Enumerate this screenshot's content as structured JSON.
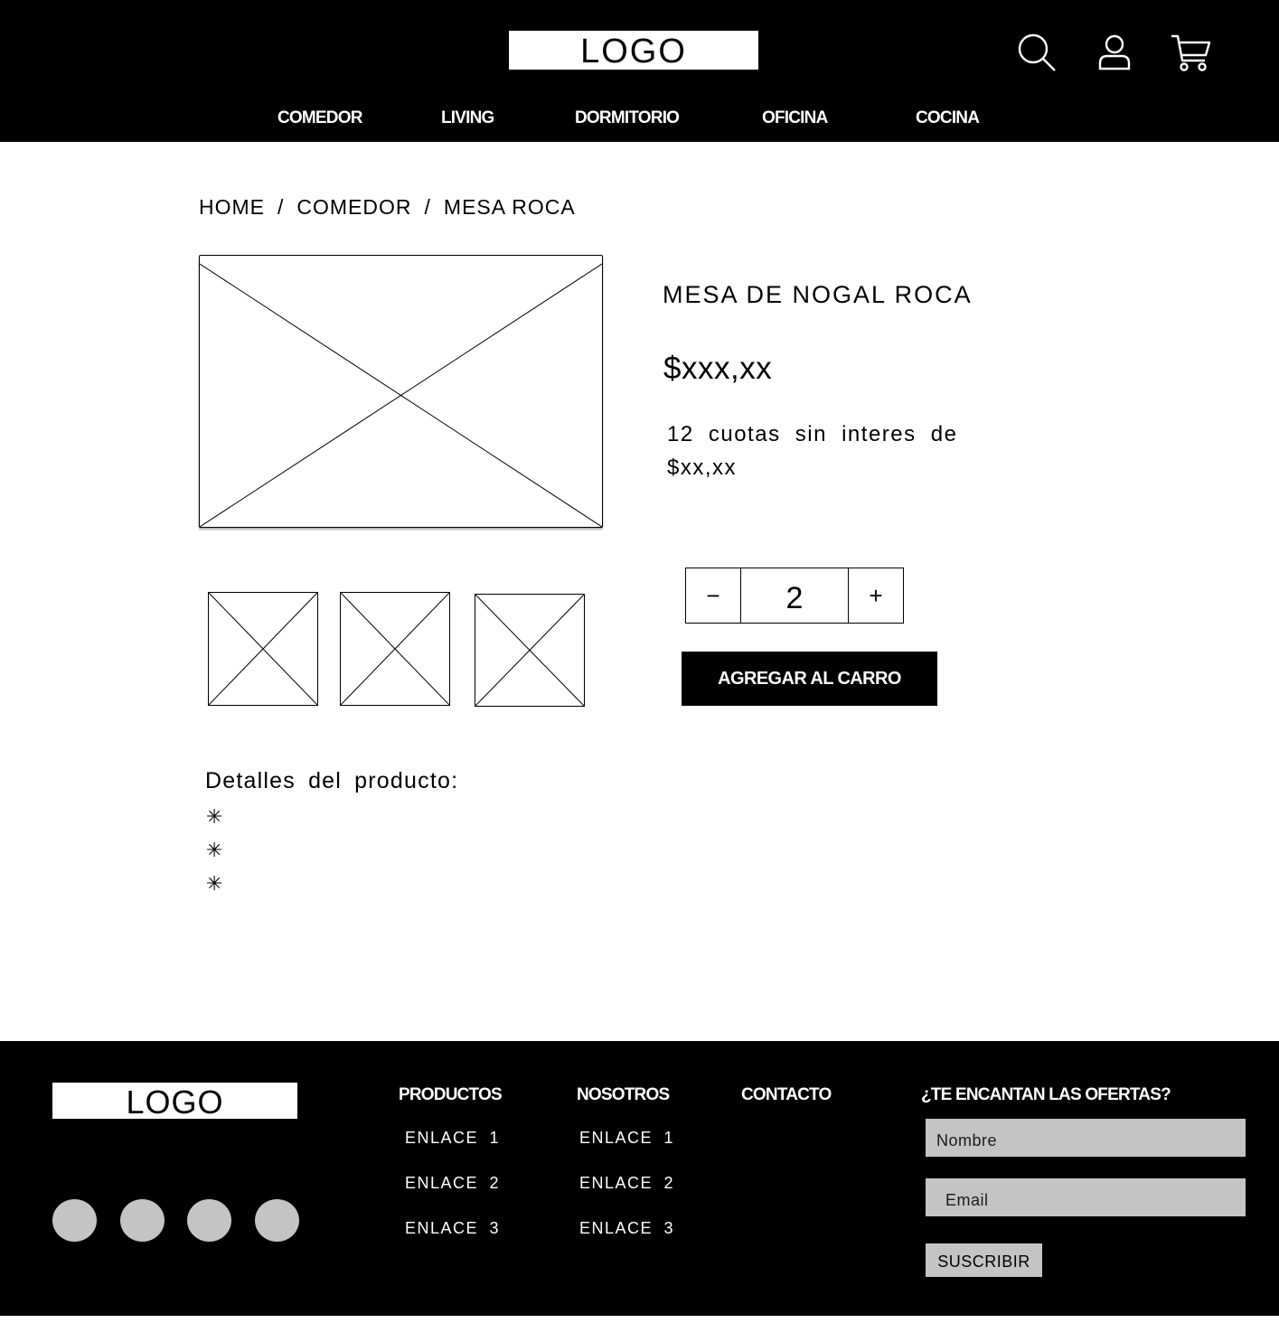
{
  "header": {
    "logo": "LOGO",
    "icons": [
      "search-icon",
      "user-icon",
      "cart-icon"
    ],
    "nav": [
      {
        "label": "COMEDOR"
      },
      {
        "label": "LIVING"
      },
      {
        "label": "DORMITORIO"
      },
      {
        "label": "OFICINA"
      },
      {
        "label": "COCINA"
      }
    ]
  },
  "breadcrumb": {
    "items": [
      "HOME",
      "COMEDOR",
      "MESA ROCA"
    ],
    "separator": "/"
  },
  "product": {
    "title": "MESA DE NOGAL ROCA",
    "price": "$xxx,xx",
    "installments": "12 cuotas sin interes de $xx,xx",
    "quantity": {
      "minus": "−",
      "value": "2",
      "plus": "+"
    },
    "add_to_cart": "AGREGAR AL CARRO",
    "details_title": "Detalles del producto:",
    "detail_bullets": [
      "✳",
      "✳",
      "✳"
    ]
  },
  "footer": {
    "logo": "LOGO",
    "social_count": 4,
    "columns": [
      {
        "heading": "PRODUCTOS",
        "links": [
          "ENLACE 1",
          "ENLACE 2",
          "ENLACE 3"
        ]
      },
      {
        "heading": "NOSOTROS",
        "links": [
          "ENLACE 1",
          "ENLACE 2",
          "ENLACE 3"
        ]
      },
      {
        "heading": "CONTACTO",
        "links": []
      }
    ],
    "newsletter": {
      "heading": "¿TE ENCANTAN LAS OFERTAS?",
      "name_placeholder": "Nombre",
      "email_placeholder": "Email",
      "subscribe": "SUSCRIBIR"
    }
  },
  "colors": {
    "header_bg": "#000000",
    "footer_bg": "#000000",
    "input_bg": "#c4c4c4",
    "social_bg": "#c4c4c4"
  }
}
